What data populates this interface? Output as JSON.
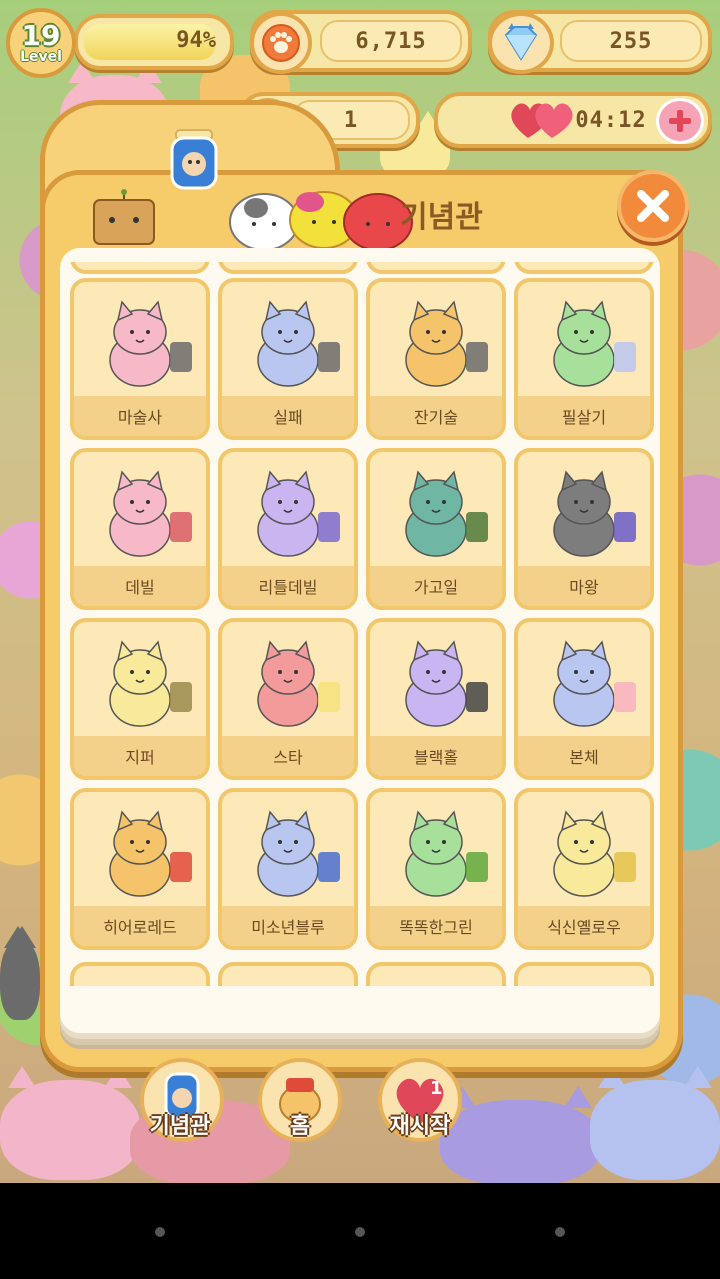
{
  "hud": {
    "level_number": "19",
    "level_word": "Level",
    "exp_percent_text": "94%",
    "exp_progress": 0.94,
    "paw_coins": "6,715",
    "gems": "255",
    "tickets": "1",
    "heart_timer": "04:12"
  },
  "panel": {
    "title": "기념관"
  },
  "cards": [
    {
      "label": "마술사",
      "color": "#f7b8c8",
      "accent": "#6b6b6b",
      "icon": "magician-cat-icon"
    },
    {
      "label": "실패",
      "color": "#b9c6f0",
      "accent": "#6b6b6b",
      "icon": "failed-trick-cat-icon"
    },
    {
      "label": "잔기술",
      "color": "#f5c46a",
      "accent": "#6b6b6b",
      "icon": "trick-cat-icon"
    },
    {
      "label": "필살기",
      "color": "#a7e09a",
      "accent": "#b9c6f0",
      "icon": "special-move-cats-icon"
    },
    {
      "label": "데빌",
      "color": "#f7b8c8",
      "accent": "#d95a66",
      "icon": "devil-cat-icon"
    },
    {
      "label": "리틀데빌",
      "color": "#cbb5f0",
      "accent": "#7b6bd0",
      "icon": "little-devil-cat-icon"
    },
    {
      "label": "가고일",
      "color": "#6fb7a2",
      "accent": "#4e7a3a",
      "icon": "gargoyle-cat-icon"
    },
    {
      "label": "마왕",
      "color": "#7d7d7d",
      "accent": "#6a5ac9",
      "icon": "demon-king-cat-icon"
    },
    {
      "label": "지퍼",
      "color": "#f8ea9a",
      "accent": "#9a8a4a",
      "icon": "zipper-cat-icon"
    },
    {
      "label": "스타",
      "color": "#f39a9a",
      "accent": "#f7e27a",
      "icon": "star-cat-icon"
    },
    {
      "label": "블랙홀",
      "color": "#c9b5f2",
      "accent": "#444444",
      "icon": "black-hole-cat-icon"
    },
    {
      "label": "본체",
      "color": "#b9c6f0",
      "accent": "#f7b0c0",
      "icon": "true-form-cat-icon"
    },
    {
      "label": "히어로레드",
      "color": "#f5c46a",
      "accent": "#e04a3a",
      "icon": "hero-red-cat-icon"
    },
    {
      "label": "미소년블루",
      "color": "#b9c6f0",
      "accent": "#4a6fd0",
      "icon": "pretty-boy-blue-cat-icon"
    },
    {
      "label": "똑똑한그린",
      "color": "#a7e09a",
      "accent": "#5ea83a",
      "icon": "smart-green-cat-icon"
    },
    {
      "label": "식신옐로우",
      "color": "#f8ea9a",
      "accent": "#e2c24a",
      "icon": "glutton-yellow-cat-icon"
    }
  ],
  "bottom_nav": {
    "memorial_label": "기념관",
    "home_label": "홈",
    "restart_label": "재시작",
    "restart_heart_cost": "1"
  }
}
